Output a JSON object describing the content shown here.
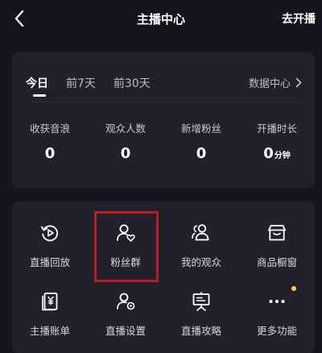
{
  "header": {
    "title": "主播中心",
    "action_label": "去开播"
  },
  "stats_card": {
    "tabs": [
      {
        "label": "今日",
        "active": true
      },
      {
        "label": "前7天",
        "active": false
      },
      {
        "label": "前30天",
        "active": false
      }
    ],
    "data_center_label": "数据中心",
    "stats": [
      {
        "label": "收获音浪",
        "value": "0",
        "unit": ""
      },
      {
        "label": "观众人数",
        "value": "0",
        "unit": ""
      },
      {
        "label": "新增粉丝",
        "value": "0",
        "unit": ""
      },
      {
        "label": "开播时长",
        "value": "0",
        "unit": "分钟"
      }
    ]
  },
  "tools": [
    {
      "label": "直播回放",
      "icon": "replay-icon"
    },
    {
      "label": "粉丝群",
      "icon": "fan-group-icon",
      "highlighted": true
    },
    {
      "label": "我的观众",
      "icon": "audience-icon"
    },
    {
      "label": "商品橱窗",
      "icon": "shop-window-icon"
    },
    {
      "label": "主播账单",
      "icon": "bill-icon"
    },
    {
      "label": "直播设置",
      "icon": "settings-icon"
    },
    {
      "label": "直播攻略",
      "icon": "guide-icon"
    },
    {
      "label": "更多功能",
      "icon": "more-icon",
      "badge_dot": true
    }
  ],
  "colors": {
    "background": "#16151d",
    "card": "#22212b",
    "highlight": "#b81d22",
    "dot": "#ffd23a"
  }
}
